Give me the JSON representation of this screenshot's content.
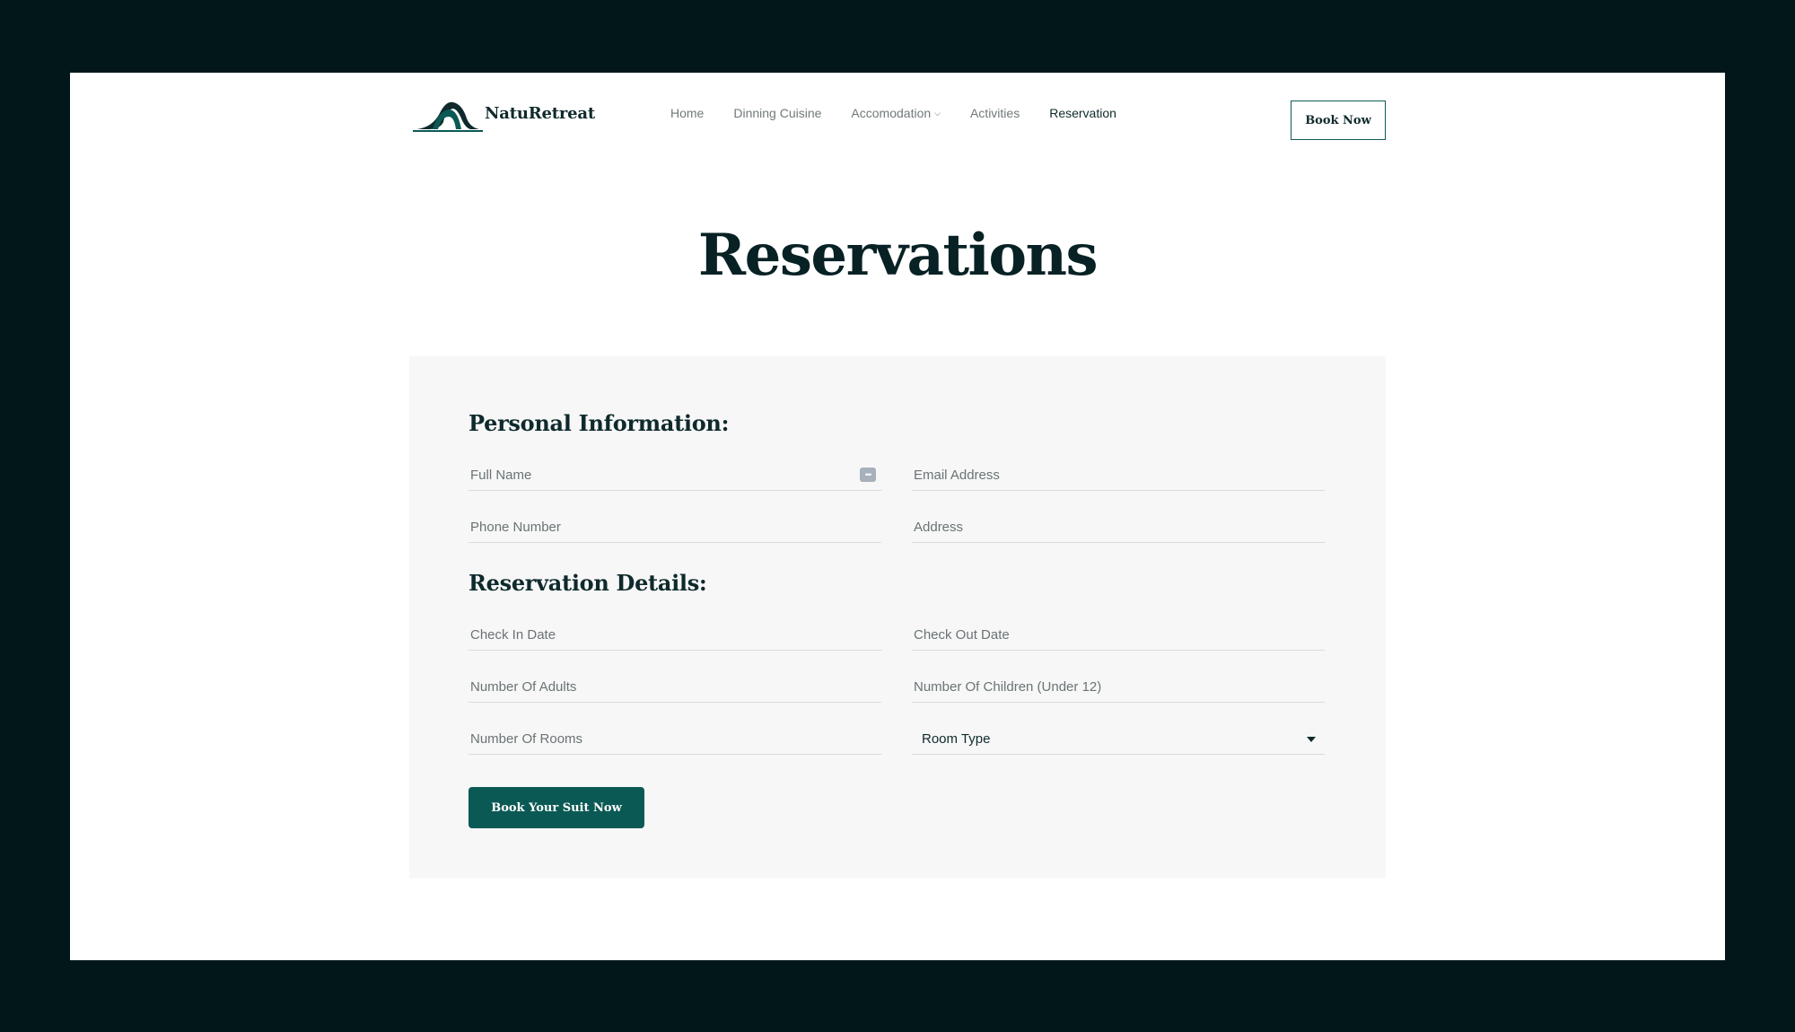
{
  "brand": {
    "name": "NatuRetreat",
    "accent": "#0b5954",
    "dark": "#0f2a2c",
    "logo_icon": "mountain-arch-icon"
  },
  "nav": {
    "items": [
      {
        "label": "Home"
      },
      {
        "label": "Dinning Cuisine"
      },
      {
        "label": "Accomodation",
        "icon": "chevron-down-icon"
      },
      {
        "label": "Activities"
      },
      {
        "label": "Reservation",
        "active": true
      }
    ],
    "cta": "Book Now"
  },
  "page_title": "Reservations",
  "personal": {
    "heading": "Personal Information:",
    "full_name": "Full Name",
    "email": "Email Address",
    "phone": "Phone Number",
    "address": "Address"
  },
  "reservation": {
    "heading": "Reservation Details:",
    "check_in": "Check In Date",
    "check_out": "Check Out Date",
    "adults": "Number Of Adults",
    "children": "Number Of Children (Under 12)",
    "rooms": "Number Of Rooms",
    "room_type": "Room Type"
  },
  "submit_label": "Book Your Suit Now"
}
